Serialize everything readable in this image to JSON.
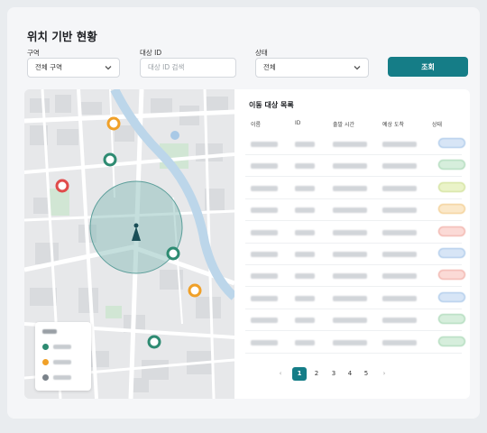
{
  "header": {
    "title": "위치 기반 현황"
  },
  "filters": {
    "region": {
      "label": "구역",
      "value": "전체 구역"
    },
    "target_id": {
      "label": "대상 ID",
      "placeholder": "대상 ID 검색"
    },
    "status": {
      "label": "상태",
      "value": "전체"
    },
    "search_label": "조회"
  },
  "colors": {
    "accent": "#157d87",
    "green": "#2e8b72",
    "orange": "#f0a028",
    "red": "#e04b4b",
    "gray": "#7a828a"
  },
  "list": {
    "title": "이동 대상 목록",
    "columns": [
      "이름",
      "ID",
      "출발 시간",
      "예상 도착",
      "상태"
    ],
    "row_statuses": [
      "blue",
      "green",
      "yellow",
      "orange",
      "red",
      "blue",
      "red",
      "blue",
      "green",
      "green"
    ]
  },
  "pagination": {
    "prev": "‹",
    "next": "›",
    "pages": [
      "1",
      "2",
      "3",
      "4",
      "5"
    ],
    "active": "1"
  }
}
